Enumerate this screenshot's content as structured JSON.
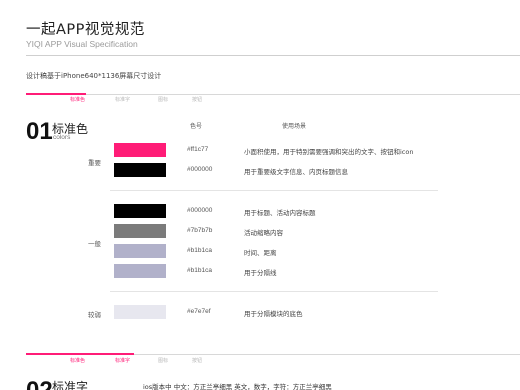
{
  "header": {
    "title": "一起APP视觉规范",
    "title_en": "YIQI APP Visual Specification",
    "subtitle": "设计稿基于iPhone640*1136屏幕尺寸设计"
  },
  "tabs": [
    "标准色",
    "标准字",
    "图标",
    "按钮"
  ],
  "tabs2": [
    "标准色",
    "标准字",
    "图标",
    "按钮"
  ],
  "section1": {
    "number": "01",
    "title": "标准色",
    "subtitle": "colors",
    "col_code": "色号",
    "col_usage": "使用场景",
    "groups": [
      {
        "label": "重要",
        "rows": [
          {
            "color": "#ff1c77",
            "code": "#ff1c77",
            "desc": "小面积使用，用于特别需要强调和突出的文字、按钮和icon"
          },
          {
            "color": "#000000",
            "code": "#000000",
            "desc": "用于重要级文字信息、内页标题信息"
          }
        ]
      },
      {
        "label": "一般",
        "rows": [
          {
            "color": "#000000",
            "code": "#000000",
            "desc": "用于标题、活动内容标题"
          },
          {
            "color": "#7b7b7b",
            "code": "#7b7b7b",
            "desc": "活动缩略内容"
          },
          {
            "color": "#b1b1ca",
            "code": "#b1b1ca",
            "desc": "时间、距离"
          },
          {
            "color": "#b1b1ca",
            "code": "#b1b1ca",
            "desc": "用于分隔线"
          }
        ]
      },
      {
        "label": "较弱",
        "rows": [
          {
            "color": "#e7e7ef",
            "code": "#e7e7ef",
            "desc": "用于分隔模块的底色"
          }
        ]
      }
    ]
  },
  "section2": {
    "number": "02",
    "title": "标准字",
    "line": "ios版本中    中文：方正兰亭细黑    英文，数字，字符：方正兰亭细黑"
  },
  "colors": {
    "accent": "#ff1c77"
  }
}
